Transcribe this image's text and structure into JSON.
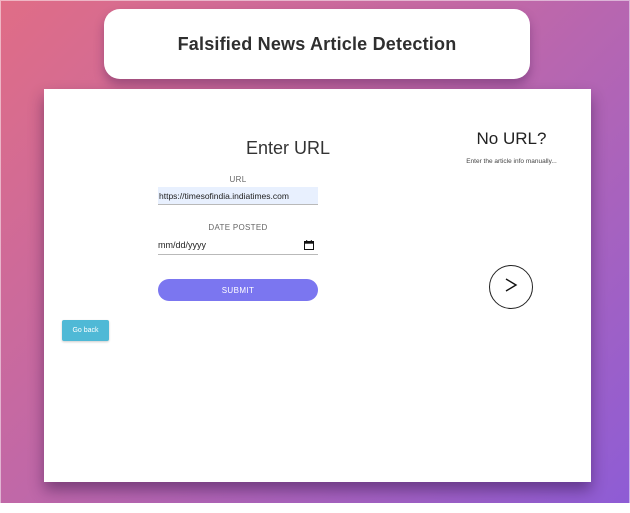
{
  "header": {
    "title": "Falsified News Article Detection"
  },
  "form": {
    "heading": "Enter URL",
    "url_label": "URL",
    "url_value": "https://timesofindia.indiatimes.com",
    "date_label": "DATE POSTED",
    "date_placeholder": "mm/dd/yyyy",
    "submit_label": "SUBMIT"
  },
  "side_panel": {
    "heading": "No URL?",
    "subtext": "Enter the article info manually...",
    "next_icon": "arrow-right-icon"
  },
  "nav": {
    "go_back_label": "Go back"
  },
  "colors": {
    "submit": "#7b76f0",
    "go_back": "#4fb9d6",
    "bg_start": "#e06d86",
    "bg_end": "#8d5cd6"
  }
}
